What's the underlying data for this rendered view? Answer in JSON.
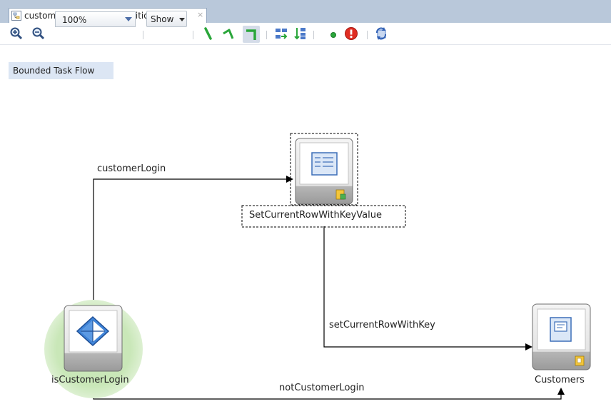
{
  "editor": {
    "tab": {
      "label": "customers-task-flow-definition.xml",
      "close": "×"
    }
  },
  "toolbar": {
    "zoom_value": "100%",
    "show_label": "Show"
  },
  "canvas": {
    "scope_label": "Bounded Task Flow",
    "nodes": {
      "router": "isCustomerLogin",
      "method_call": "SetCurrentRowWithKeyValue",
      "view": "Customers"
    },
    "edges": {
      "e1": "customerLogin",
      "e2": "setCurrentRowWithKey",
      "e3": "notCustomerLogin"
    }
  }
}
